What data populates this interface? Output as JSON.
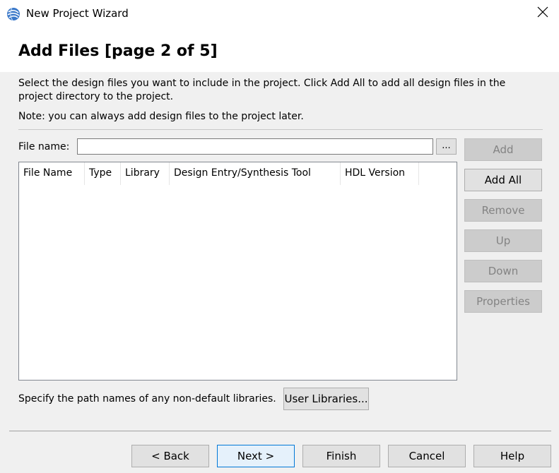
{
  "window": {
    "title": "New Project Wizard"
  },
  "header": {
    "heading": "Add Files [page 2 of 5]"
  },
  "body": {
    "description": "Select the design files you want to include in the project. Click Add All to add all design files in the project directory to the project.",
    "note": "Note: you can always add design files to the project later."
  },
  "file_name": {
    "label": "File name:",
    "value": "",
    "browse_label": "..."
  },
  "table": {
    "columns": [
      "File Name",
      "Type",
      "Library",
      "Design Entry/Synthesis Tool",
      "HDL Version"
    ],
    "rows": []
  },
  "side_buttons": {
    "add": "Add",
    "add_all": "Add All",
    "remove": "Remove",
    "up": "Up",
    "down": "Down",
    "properties": "Properties"
  },
  "libraries": {
    "label": "Specify the path names of any non-default libraries.",
    "button": "User Libraries..."
  },
  "footer": {
    "back": "< Back",
    "next": "Next >",
    "finish": "Finish",
    "cancel": "Cancel",
    "help": "Help"
  },
  "colors": {
    "dialog_bg": "#f0f0f0",
    "header_bg": "#ffffff",
    "default_button_border": "#0078d7",
    "disabled_text": "#838383"
  },
  "icons": {
    "app": "quartus-globe-icon",
    "close": "close-icon"
  }
}
